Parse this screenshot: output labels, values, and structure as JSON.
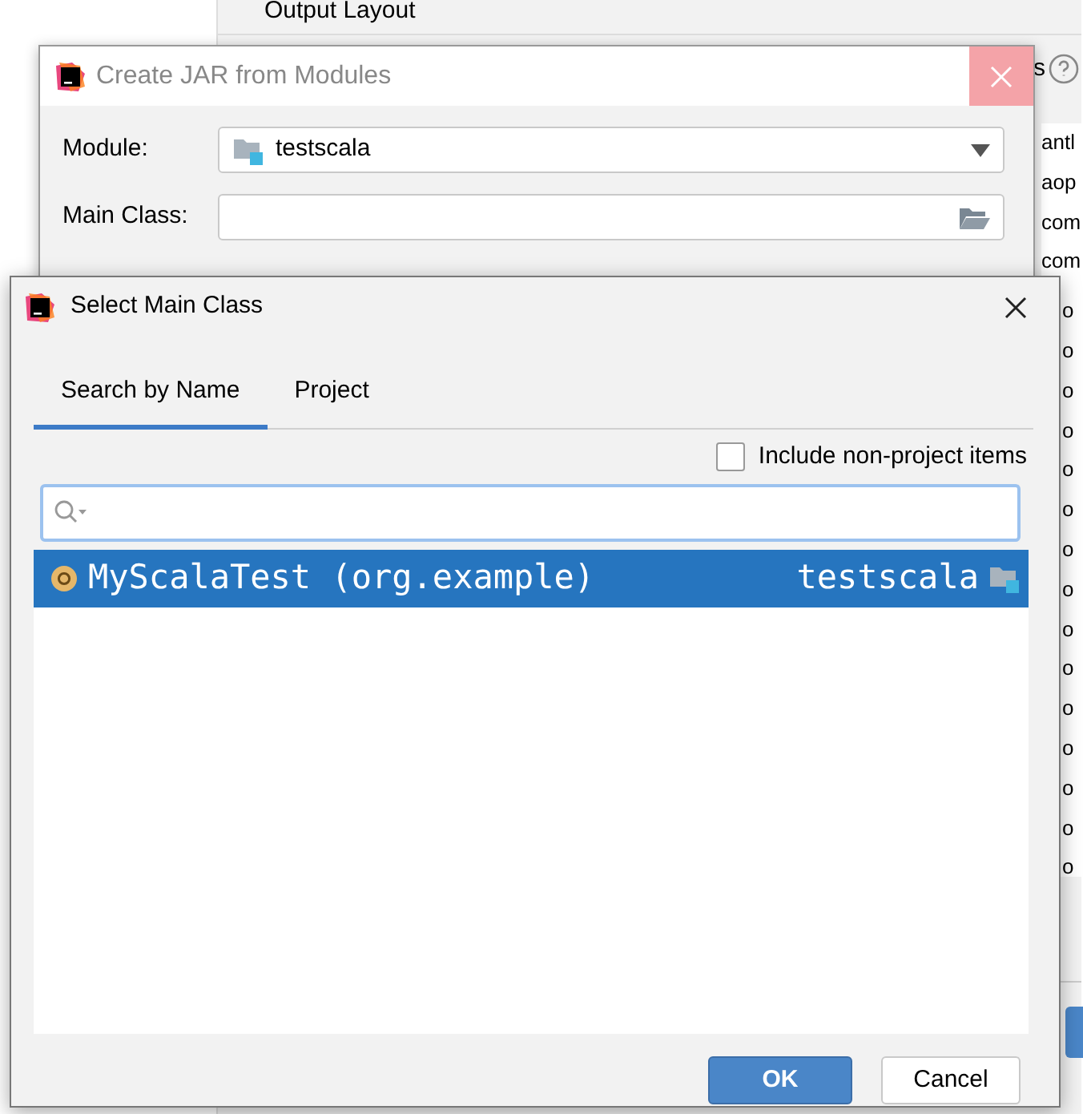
{
  "background_window": {
    "heading": "Output Layout",
    "partial_label": "s",
    "list_items": [
      "antl",
      "aop",
      "com",
      "com"
    ],
    "covered_items": [
      "o",
      "o",
      "o",
      "o",
      "o",
      "o",
      "o",
      "o",
      "o",
      "o",
      "o",
      "o",
      "o",
      "o",
      "o"
    ]
  },
  "jar_dialog": {
    "title": "Create JAR from Modules",
    "fields": [
      {
        "label": "Module:",
        "kind": "combo",
        "value": "testscala"
      },
      {
        "label": "Main Class:",
        "kind": "browse"
      }
    ]
  },
  "select_dialog": {
    "title": "Select Main Class",
    "tabs": [
      {
        "label": "Search by Name",
        "selected": true
      },
      {
        "label": "Project",
        "selected": false
      }
    ],
    "include_non_project": {
      "label": "Include non-project items",
      "checked": false
    },
    "results": [
      {
        "name": "MyScalaTest (org.example)",
        "module": "testscala",
        "selected": true
      }
    ],
    "buttons": [
      {
        "label": "OK",
        "kind": "primary"
      },
      {
        "label": "Cancel",
        "kind": "secondary"
      }
    ]
  }
}
